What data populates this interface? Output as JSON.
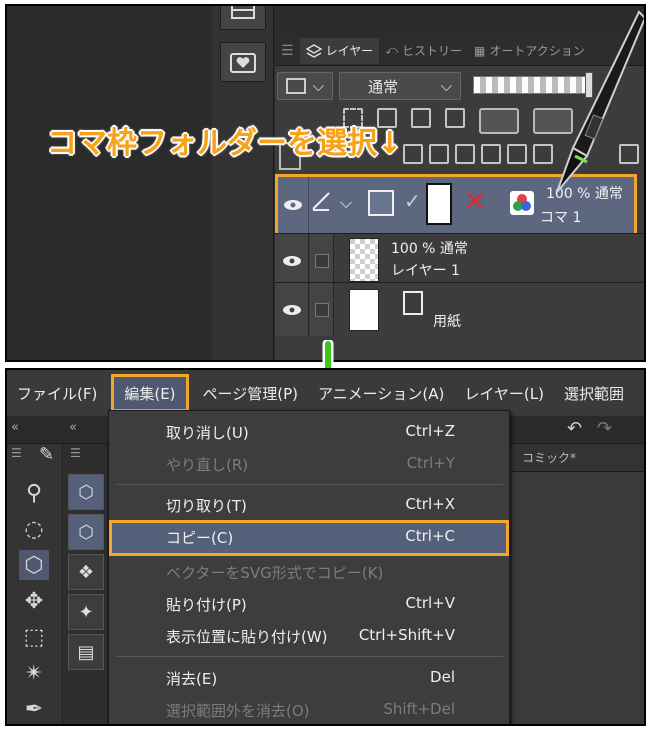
{
  "layer_panel": {
    "tabs": [
      {
        "label": "レイヤー",
        "active": true
      },
      {
        "label": "ヒストリー",
        "active": false
      },
      {
        "label": "オートアクション",
        "active": false
      }
    ],
    "blend_mode": "通常",
    "caption": "コマ枠フォルダーを選択↓",
    "layers": [
      {
        "line1": "100 % 通常",
        "line2": "コマ 1",
        "selected": true
      },
      {
        "line1": "100 % 通常",
        "line2": "レイヤー 1",
        "selected": false
      },
      {
        "line1": "",
        "line2": "用紙",
        "selected": false
      }
    ]
  },
  "menubar": {
    "items": [
      {
        "label": "ファイル(F)"
      },
      {
        "label": "編集(E)",
        "open": true
      },
      {
        "label": "ページ管理(P)"
      },
      {
        "label": "アニメーション(A)"
      },
      {
        "label": "レイヤー(L)"
      },
      {
        "label": "選択範囲"
      }
    ]
  },
  "doc_tab": "コミック*",
  "edit_menu": {
    "items": [
      {
        "label": "取り消し(U)",
        "shortcut": "Ctrl+Z",
        "disabled": false
      },
      {
        "label": "やり直し(R)",
        "shortcut": "Ctrl+Y",
        "disabled": true
      },
      {
        "label": "切り取り(T)",
        "shortcut": "Ctrl+X",
        "disabled": false
      },
      {
        "label": "コピー(C)",
        "shortcut": "Ctrl+C",
        "disabled": false,
        "highlighted": true
      },
      {
        "label": "ベクターをSVG形式でコピー(K)",
        "shortcut": "",
        "disabled": true
      },
      {
        "label": "貼り付け(P)",
        "shortcut": "Ctrl+V",
        "disabled": false
      },
      {
        "label": "表示位置に貼り付け(W)",
        "shortcut": "Ctrl+Shift+V",
        "disabled": false
      },
      {
        "label": "消去(E)",
        "shortcut": "Del",
        "disabled": false
      },
      {
        "label": "選択範囲外を消去(O)",
        "shortcut": "Shift+Del",
        "disabled": true
      }
    ]
  },
  "colors": {
    "highlight_border": "#f3a62b",
    "selection_fill": "#55607a",
    "arrow_green": "#3ec71a",
    "caption_orange": "#f7a21a"
  }
}
